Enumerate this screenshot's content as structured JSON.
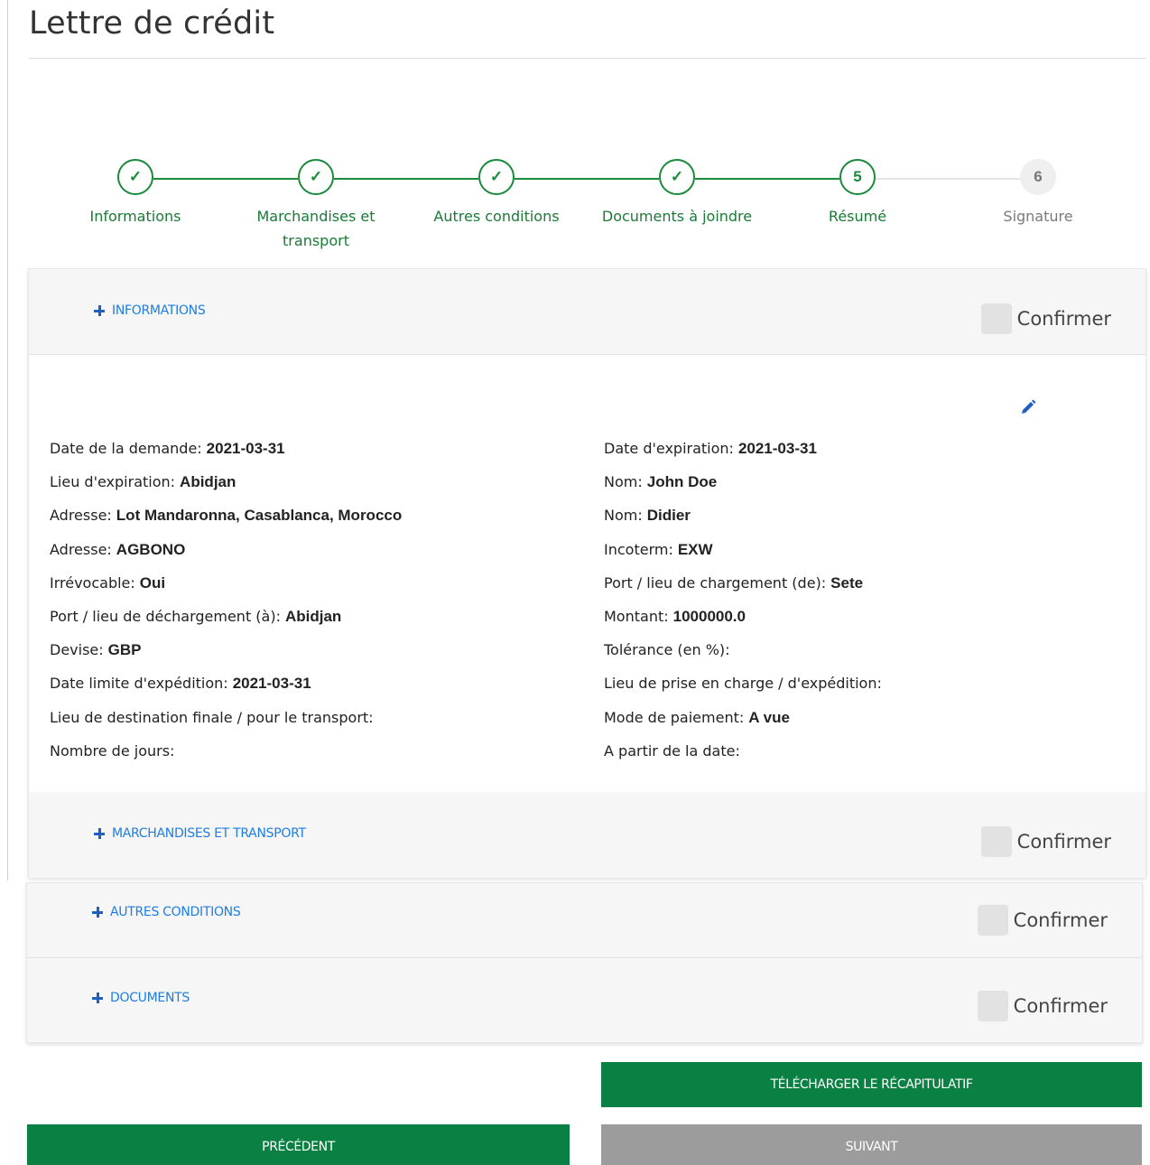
{
  "page": {
    "title": "Lettre de crédit"
  },
  "colors": {
    "accent_green": "#0a8043",
    "step_green": "#1a8a3c",
    "link_blue": "#1f7de0",
    "disabled_grey": "#9c9c9c"
  },
  "stepper": {
    "steps": [
      {
        "label": "Informations",
        "state": "done",
        "marker": "✓"
      },
      {
        "label": "Marchandises et transport",
        "state": "done",
        "marker": "✓"
      },
      {
        "label": "Autres conditions",
        "state": "done",
        "marker": "✓"
      },
      {
        "label": "Documents à joindre",
        "state": "done",
        "marker": "✓"
      },
      {
        "label": "Résumé",
        "state": "current",
        "marker": "5"
      },
      {
        "label": "Signature",
        "state": "future",
        "marker": "6"
      }
    ]
  },
  "sections": {
    "informations": {
      "title": "INFORMATIONS",
      "confirm_label": "Confirmer",
      "expanded": true
    },
    "marchandises": {
      "title": "MARCHANDISES ET TRANSPORT",
      "confirm_label": "Confirmer",
      "expanded": false
    },
    "autres": {
      "title": "AUTRES CONDITIONS",
      "confirm_label": "Confirmer",
      "expanded": false
    },
    "documents": {
      "title": "DOCUMENTS",
      "confirm_label": "Confirmer",
      "expanded": false
    }
  },
  "details": {
    "left": [
      {
        "label": "Date de la demande:",
        "value": "2021-03-31"
      },
      {
        "label": "Lieu d'expiration:",
        "value": "Abidjan"
      },
      {
        "label": "Adresse:",
        "value": "Lot Mandaronna, Casablanca, Morocco"
      },
      {
        "label": "Adresse:",
        "value": "AGBONO"
      },
      {
        "label": "Irrévocable:",
        "value": "Oui"
      },
      {
        "label": "Port / lieu de déchargement (à):",
        "value": "Abidjan"
      },
      {
        "label": "Devise:",
        "value": "GBP"
      },
      {
        "label": "Date limite d'expédition:",
        "value": "2021-03-31"
      },
      {
        "label": "Lieu de destination finale / pour le transport:",
        "value": ""
      },
      {
        "label": "Nombre de jours:",
        "value": ""
      }
    ],
    "right": [
      {
        "label": "Date d'expiration:",
        "value": "2021-03-31"
      },
      {
        "label": "Nom:",
        "value": "John Doe"
      },
      {
        "label": "Nom:",
        "value": "Didier"
      },
      {
        "label": "Incoterm:",
        "value": "EXW"
      },
      {
        "label": "Port / lieu de chargement (de):",
        "value": "Sete"
      },
      {
        "label": "Montant:",
        "value": "1000000.0"
      },
      {
        "label": "Tolérance (en %):",
        "value": ""
      },
      {
        "label": "Lieu de prise en charge / d'expédition:",
        "value": ""
      },
      {
        "label": "Mode de paiement:",
        "value": "A vue"
      },
      {
        "label": "A partir de la date:",
        "value": ""
      }
    ]
  },
  "icons": {
    "edit": "pencil-icon",
    "expand": "plus-icon",
    "check": "check-icon"
  },
  "actions": {
    "download_label": "TÉLÉCHARGER LE RÉCAPITULATIF",
    "previous_label": "PRÉCÉDENT",
    "next_label": "SUIVANT"
  }
}
